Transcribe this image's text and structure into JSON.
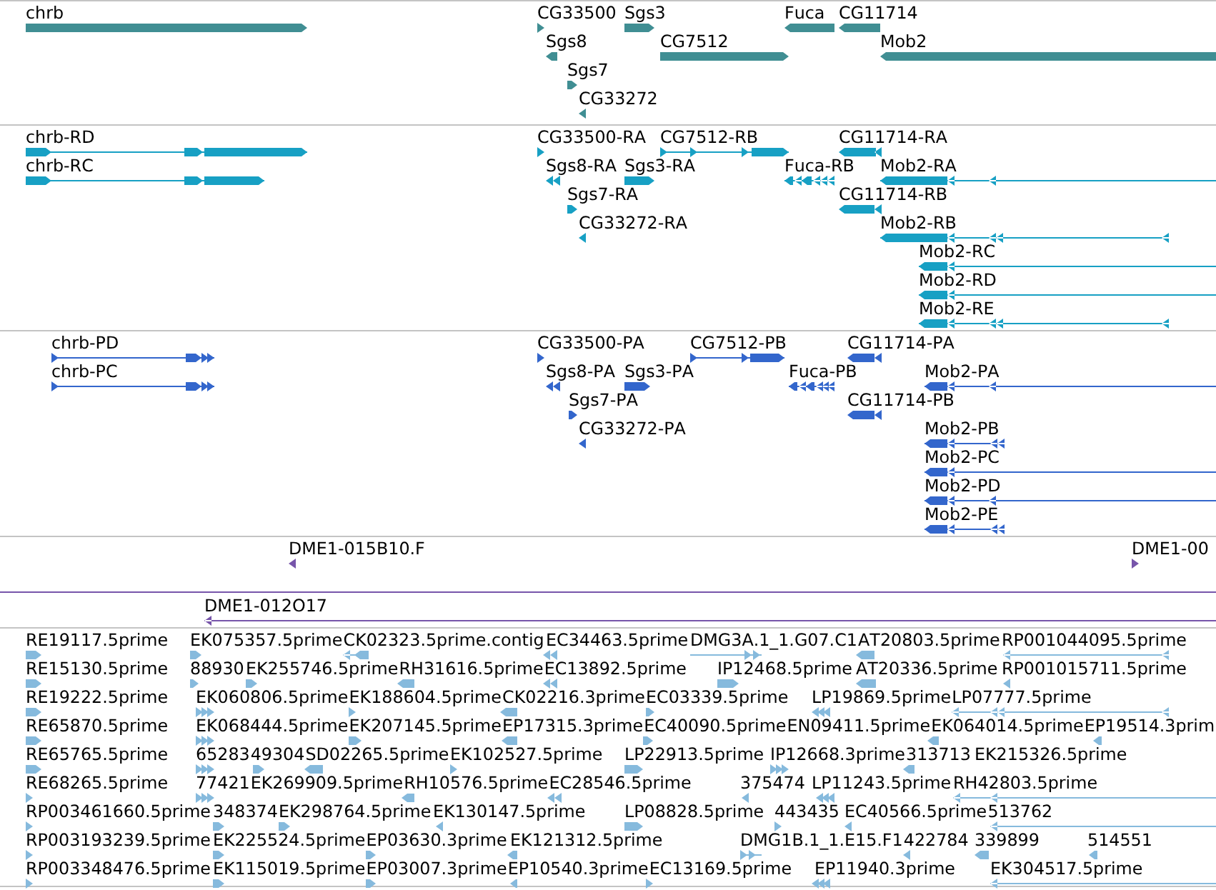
{
  "tracks": [
    {
      "kind": "gene",
      "lanes": [
        {
          "features": [
            {
              "label": "chrb",
              "reverse": false
            },
            {
              "label": "CG33500",
              "reverse": false
            },
            {
              "label": "Sgs3",
              "reverse": false
            },
            {
              "label": "Fuca",
              "reverse": true
            },
            {
              "label": "CG11714",
              "reverse": true
            }
          ]
        },
        {
          "features": [
            {
              "label": "Sgs8",
              "reverse": true
            },
            {
              "label": "CG7512",
              "reverse": false
            },
            {
              "label": "Mob2",
              "reverse": true
            }
          ]
        },
        {
          "features": [
            {
              "label": "Sgs7",
              "reverse": false
            }
          ]
        },
        {
          "features": [
            {
              "label": "CG33272",
              "reverse": true
            }
          ]
        }
      ]
    },
    {
      "kind": "transcript",
      "lanes": [
        {
          "features": [
            {
              "label": "chrb-RD",
              "reverse": false
            },
            {
              "label": "CG33500-RA",
              "reverse": false
            },
            {
              "label": "CG7512-RB",
              "reverse": false
            },
            {
              "label": "CG11714-RA",
              "reverse": true
            }
          ]
        },
        {
          "features": [
            {
              "label": "chrb-RC",
              "reverse": false
            },
            {
              "label": "Sgs8-RA",
              "reverse": true
            },
            {
              "label": "Sgs3-RA",
              "reverse": false
            },
            {
              "label": "Fuca-RB",
              "reverse": true
            },
            {
              "label": "Mob2-RA",
              "reverse": true
            }
          ]
        },
        {
          "features": [
            {
              "label": "Sgs7-RA",
              "reverse": false
            },
            {
              "label": "CG11714-RB",
              "reverse": true
            }
          ]
        },
        {
          "features": [
            {
              "label": "CG33272-RA",
              "reverse": true
            },
            {
              "label": "Mob2-RB",
              "reverse": true
            }
          ]
        },
        {
          "features": [
            {
              "label": "Mob2-RC",
              "reverse": true
            }
          ]
        },
        {
          "features": [
            {
              "label": "Mob2-RD",
              "reverse": true
            }
          ]
        },
        {
          "features": [
            {
              "label": "Mob2-RE",
              "reverse": true
            }
          ]
        }
      ]
    },
    {
      "kind": "protein",
      "lanes": [
        {
          "features": [
            {
              "label": "chrb-PD",
              "reverse": false
            },
            {
              "label": "CG33500-PA",
              "reverse": false
            },
            {
              "label": "CG7512-PB",
              "reverse": false
            },
            {
              "label": "CG11714-PA",
              "reverse": true
            }
          ]
        },
        {
          "features": [
            {
              "label": "chrb-PC",
              "reverse": false
            },
            {
              "label": "Sgs8-PA",
              "reverse": true
            },
            {
              "label": "Sgs3-PA",
              "reverse": false
            },
            {
              "label": "Fuca-PB",
              "reverse": true
            },
            {
              "label": "Mob2-PA",
              "reverse": true
            }
          ]
        },
        {
          "features": [
            {
              "label": "Sgs7-PA",
              "reverse": false
            },
            {
              "label": "CG11714-PB",
              "reverse": true
            }
          ]
        },
        {
          "features": [
            {
              "label": "CG33272-PA",
              "reverse": true
            },
            {
              "label": "Mob2-PB",
              "reverse": true
            }
          ]
        },
        {
          "features": [
            {
              "label": "Mob2-PC",
              "reverse": true
            }
          ]
        },
        {
          "features": [
            {
              "label": "Mob2-PD",
              "reverse": true
            }
          ]
        },
        {
          "features": [
            {
              "label": "Mob2-PE",
              "reverse": true
            }
          ]
        }
      ]
    },
    {
      "kind": "clone",
      "lanes": [
        {
          "features": [
            {
              "label": "DME1-015B10.F",
              "reverse": true
            },
            {
              "label": "DME1-00",
              "reverse": false
            }
          ]
        },
        {
          "features": [
            {
              "kind": "line"
            }
          ]
        },
        {
          "features": [
            {
              "label": "DME1-012O17",
              "reverse": true
            }
          ]
        }
      ]
    },
    {
      "kind": "est",
      "lanes": [
        {
          "features": [
            {
              "label": "RE19117.5prime",
              "reverse": false
            },
            {
              "label": "EK075357.5prime",
              "reverse": false
            },
            {
              "label": "CK02323.5prime.contig",
              "reverse": true
            },
            {
              "label": "EC34463.5prime",
              "reverse": true
            },
            {
              "label": "DMG3A.1_1.G07.C1",
              "reverse": false
            },
            {
              "label": "AT20803.5prime",
              "reverse": true
            },
            {
              "label": "RP001044095.5prime",
              "reverse": true
            }
          ]
        },
        {
          "features": [
            {
              "label": "RE15130.5prime",
              "reverse": false
            },
            {
              "label": "88930",
              "reverse": false
            },
            {
              "label": "EK255746.5prime",
              "reverse": false
            },
            {
              "label": "RH31616.5prime",
              "reverse": true
            },
            {
              "label": "EC13892.5prime",
              "reverse": true
            },
            {
              "label": "IP12468.5prime",
              "reverse": false
            },
            {
              "label": "AT20336.5prime",
              "reverse": true
            },
            {
              "label": "RP001015711.5prime",
              "reverse": true
            }
          ]
        },
        {
          "features": [
            {
              "label": "RE19222.5prime",
              "reverse": false
            },
            {
              "label": "EK060806.5prime",
              "reverse": false
            },
            {
              "label": "EK188604.5prime",
              "reverse": false
            },
            {
              "label": "CK02216.3prime",
              "reverse": true
            },
            {
              "label": "EC03339.5prime",
              "reverse": false
            },
            {
              "label": "LP19869.5prime",
              "reverse": true
            },
            {
              "label": "LP07777.5prime",
              "reverse": true
            }
          ]
        },
        {
          "features": [
            {
              "label": "RE65870.5prime",
              "reverse": false
            },
            {
              "label": "EK068444.5prime",
              "reverse": false
            },
            {
              "label": "EK207145.5prime",
              "reverse": false
            },
            {
              "label": "EP17315.3prime",
              "reverse": true
            },
            {
              "label": "EC40090.5prime",
              "reverse": false
            },
            {
              "label": "EN09411.5prime"
            },
            {
              "label": "EK064014.5prime",
              "reverse": true
            },
            {
              "label": "EP19514.3prim",
              "reverse": true
            }
          ]
        },
        {
          "features": [
            {
              "label": "RE65765.5prime",
              "reverse": false
            },
            {
              "label": "65283",
              "reverse": false
            },
            {
              "label": "49304",
              "reverse": false
            },
            {
              "label": "SD02265.5prime",
              "reverse": true
            },
            {
              "label": "EK102527.5prime",
              "reverse": false
            },
            {
              "label": "LP22913.5prime",
              "reverse": false
            },
            {
              "label": "IP12668.3prime",
              "reverse": false
            },
            {
              "label": "313713",
              "reverse": true
            },
            {
              "label": "EK215326.5prime"
            }
          ]
        },
        {
          "features": [
            {
              "label": "RE68265.5prime",
              "reverse": false
            },
            {
              "label": "77421",
              "reverse": false
            },
            {
              "label": "EK269909.5prime"
            },
            {
              "label": "RH10576.5prime",
              "reverse": true
            },
            {
              "label": "EC28546.5prime",
              "reverse": true
            },
            {
              "label": "375474",
              "reverse": true
            },
            {
              "label": "LP11243.5prime",
              "reverse": true
            },
            {
              "label": "RH42803.5prime",
              "reverse": true
            }
          ]
        },
        {
          "features": [
            {
              "label": "RP003461660.5prime",
              "reverse": false
            },
            {
              "label": "348374",
              "reverse": false
            },
            {
              "label": "EK298764.5prime",
              "reverse": false
            },
            {
              "label": "EK130147.5prime",
              "reverse": true
            },
            {
              "label": "LP08828.5prime",
              "reverse": false
            },
            {
              "label": "443435",
              "reverse": false
            },
            {
              "label": "EC40566.5prime",
              "reverse": true
            },
            {
              "label": "513762",
              "reverse": true
            }
          ]
        },
        {
          "features": [
            {
              "label": "RP003193239.5prime",
              "reverse": false
            },
            {
              "label": "EK225524.5prime",
              "reverse": false
            },
            {
              "label": "EP03630.3prime",
              "reverse": false
            },
            {
              "label": "EK121312.5prime",
              "reverse": true
            },
            {
              "label": "DMG1B.1_1.E15.F1",
              "reverse": false
            },
            {
              "label": "422784",
              "reverse": true
            },
            {
              "label": "339899",
              "reverse": true
            },
            {
              "label": "514551",
              "reverse": true
            }
          ]
        },
        {
          "features": [
            {
              "label": "RP003348476.5prime",
              "reverse": false
            },
            {
              "label": "EK115019.5prime",
              "reverse": false
            },
            {
              "label": "EP03007.3prime",
              "reverse": false
            },
            {
              "label": "EP10540.3prime",
              "reverse": true
            },
            {
              "label": "EC13169.5prime",
              "reverse": false
            },
            {
              "label": "EP11940.3prime",
              "reverse": true
            },
            {
              "label": "EK304517.5prime",
              "reverse": true
            }
          ]
        }
      ]
    }
  ]
}
